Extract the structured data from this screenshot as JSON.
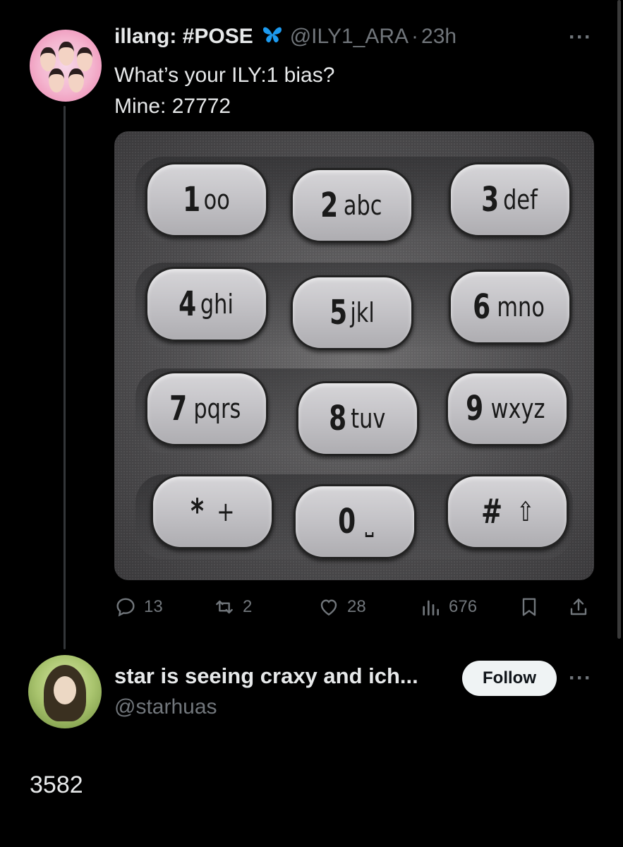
{
  "tweet": {
    "display_name": "illang: #POSE",
    "verified_icon": "butterfly-icon",
    "handle": "@ILY1_ARA",
    "separator": "·",
    "time": "23h",
    "text_line1": "What’s your ILY:1 bias?",
    "text_line2": "Mine: 27772",
    "more_label": "···",
    "keypad": [
      {
        "digit": "1",
        "letters": "oo"
      },
      {
        "digit": "2",
        "letters": "abc"
      },
      {
        "digit": "3",
        "letters": "def"
      },
      {
        "digit": "4",
        "letters": "ghi"
      },
      {
        "digit": "5",
        "letters": "jkl"
      },
      {
        "digit": "6",
        "letters": "mno"
      },
      {
        "digit": "7",
        "letters": "pqrs"
      },
      {
        "digit": "8",
        "letters": "tuv"
      },
      {
        "digit": "9",
        "letters": "wxyz"
      },
      {
        "digit": "*",
        "letters": "+"
      },
      {
        "digit": "0",
        "letters": "⎵"
      },
      {
        "digit": "#",
        "letters": "⇧"
      }
    ],
    "actions": {
      "replies": "13",
      "reposts": "2",
      "likes": "28",
      "views": "676"
    }
  },
  "reply": {
    "display_name": "star is seeing craxy and ich...",
    "handle": "@starhuas",
    "follow_label": "Follow",
    "more_label": "···",
    "text": "3582"
  }
}
